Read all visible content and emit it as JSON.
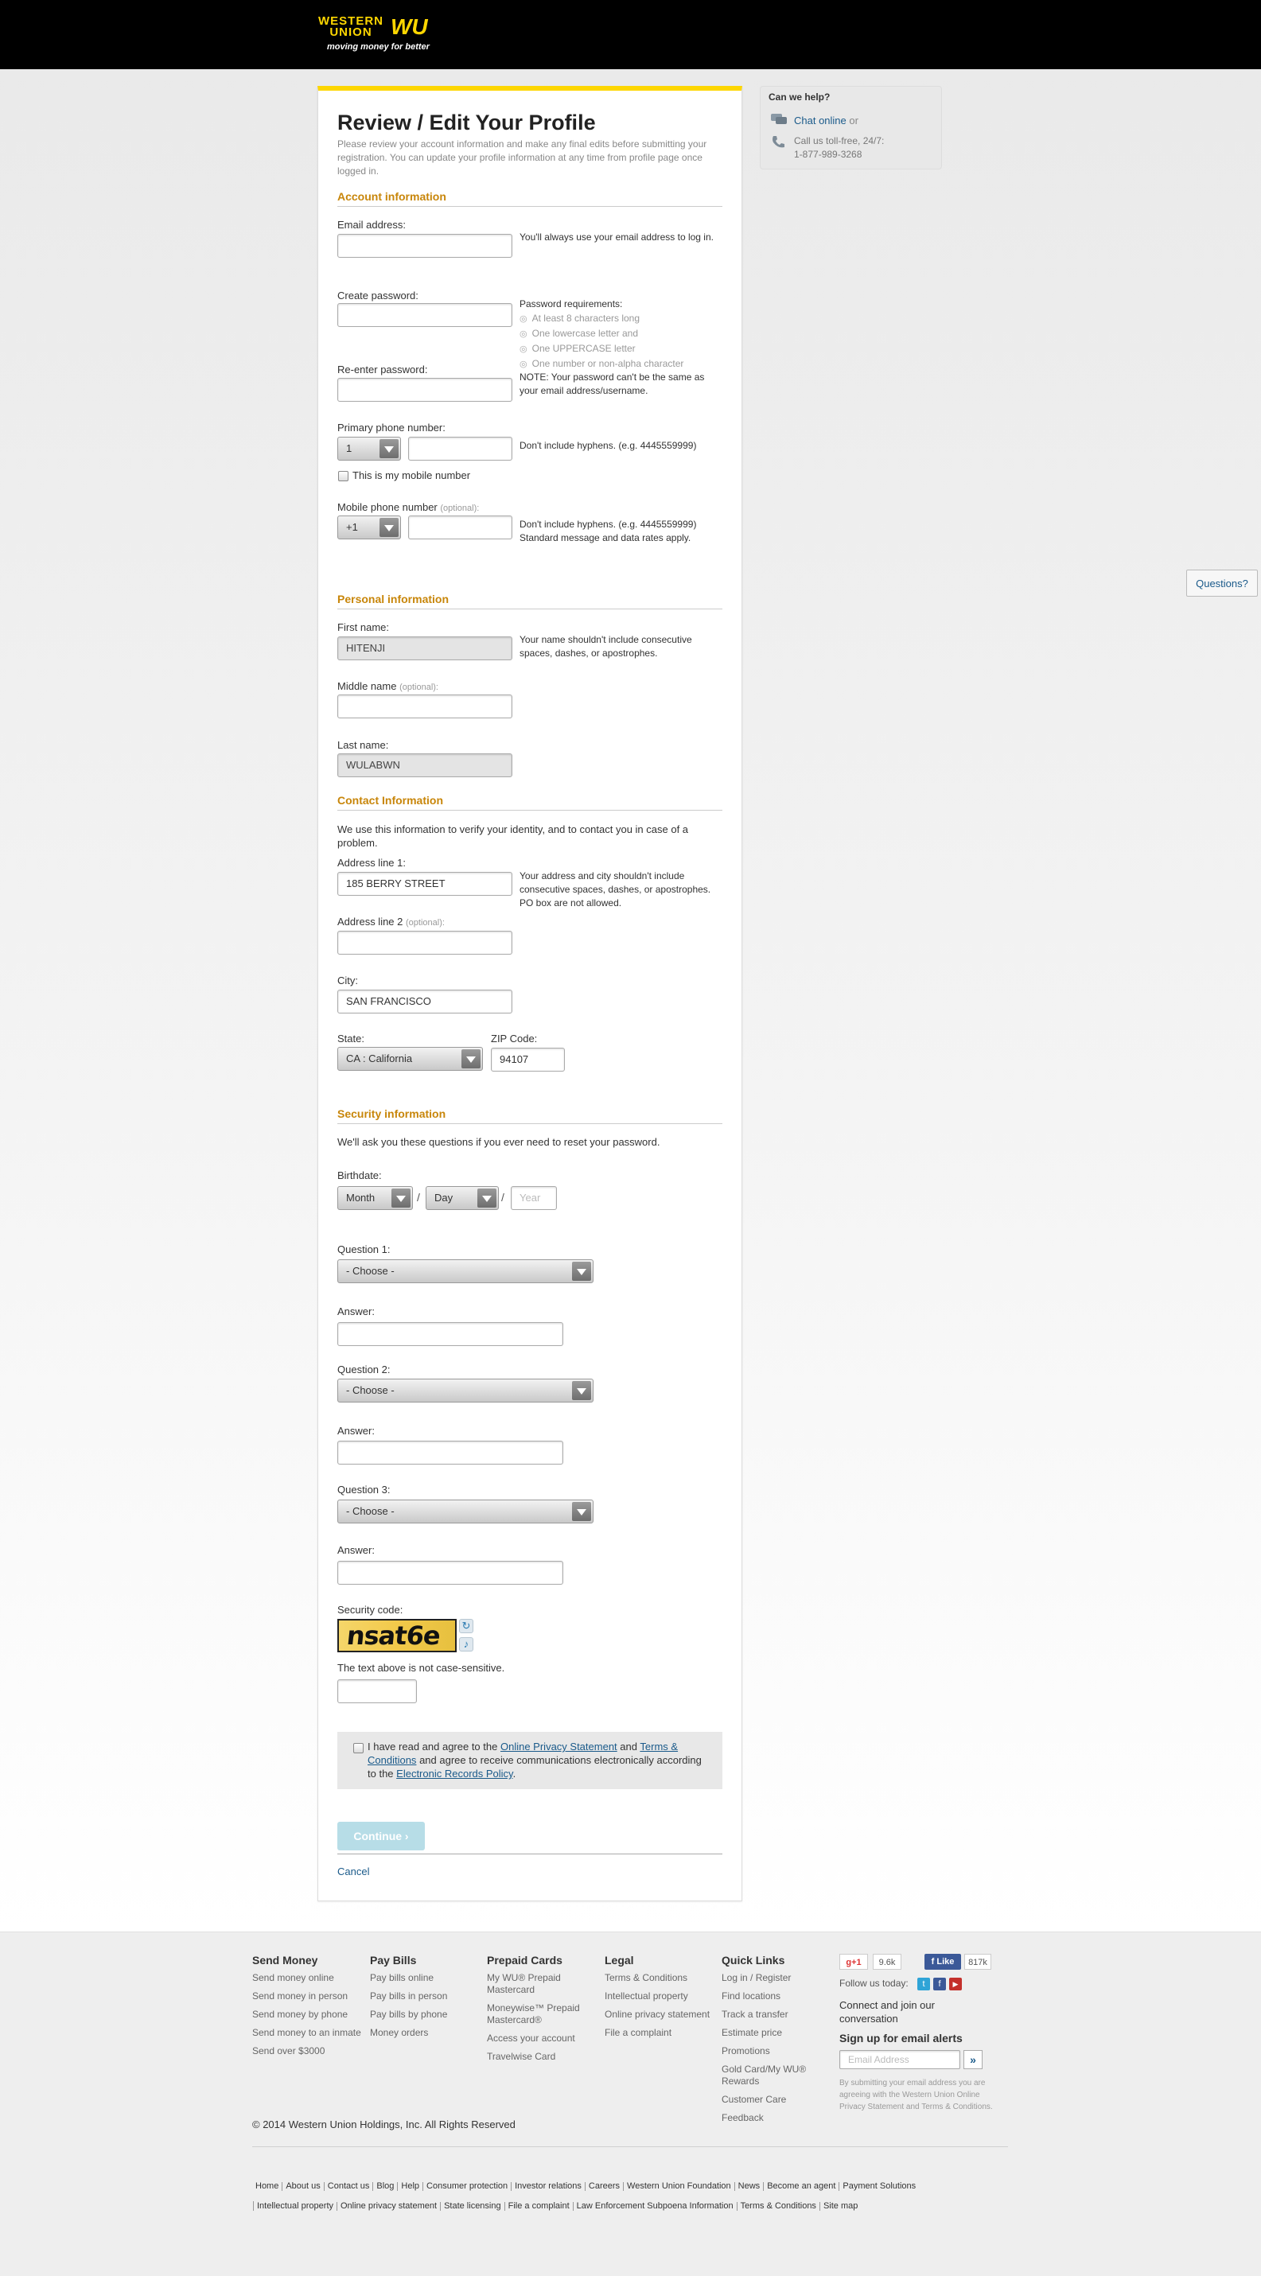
{
  "header": {
    "logo_wordmark_line1": "WESTERN",
    "logo_wordmark_line2": "UNION",
    "logo_mark": "WU",
    "tagline": "moving money for better"
  },
  "page": {
    "title": "Review / Edit Your Profile",
    "intro": "Please review your account information and make any final edits before submitting your registration. You can update your profile information at any time from profile page once logged in."
  },
  "account": {
    "heading": "Account information",
    "email_label": "Email address:",
    "email_hint": "You'll always use your email address to log in.",
    "create_password_label": "Create password:",
    "password_req_title": "Password requirements:",
    "password_reqs": [
      "At least 8 characters long",
      "One lowercase letter and",
      "One UPPERCASE letter",
      "One number or non-alpha character"
    ],
    "reenter_password_label": "Re-enter password:",
    "password_note": "NOTE: Your password can't be the same as your email address/username.",
    "primary_phone_label": "Primary phone number:",
    "primary_phone_code": "1",
    "primary_phone_hint": "Don't include hyphens. (e.g. 4445559999)",
    "mobile_checkbox_label": "This is my mobile number",
    "mobile_phone_label": "Mobile phone number",
    "optional": "(optional):",
    "mobile_phone_code": "+1",
    "mobile_phone_hint": "Don't include hyphens. (e.g. 4445559999) Standard message and data rates apply."
  },
  "personal": {
    "heading": "Personal information",
    "first_name_label": "First name:",
    "first_name_value": "HITENJI",
    "name_hint": "Your name shouldn't include consecutive spaces, dashes, or apostrophes.",
    "middle_name_label": "Middle name",
    "last_name_label": "Last name:",
    "last_name_value": "WULABWN"
  },
  "contact": {
    "heading": "Contact Information",
    "intro": "We use this information to verify your identity, and to contact you in case of a problem.",
    "address1_label": "Address line 1:",
    "address1_value": "185 BERRY STREET",
    "address_hint": "Your address and city shouldn't include consecutive spaces, dashes, or apostrophes. PO box are not allowed.",
    "address2_label": "Address line 2",
    "city_label": "City:",
    "city_value": "SAN FRANCISCO",
    "state_label": "State:",
    "state_value": "CA : California",
    "zip_label": "ZIP Code:",
    "zip_value": "94107"
  },
  "security": {
    "heading": "Security information",
    "intro": "We'll ask you these questions if you ever need to reset your password.",
    "birthdate_label": "Birthdate:",
    "month_value": "Month",
    "day_value": "Day",
    "year_placeholder": "Year",
    "slash": "/",
    "question1_label": "Question 1:",
    "question2_label": "Question 2:",
    "question3_label": "Question 3:",
    "choose_value": "- Choose -",
    "answer_label": "Answer:",
    "security_code_label": "Security code:",
    "captcha_text": "nsat6e",
    "case_note": "The text above is not case-sensitive."
  },
  "agreement": {
    "text_part1": "I have read and agree to the",
    "privacy_link": "Online Privacy Statement",
    "and": "and",
    "terms_link": "Terms & Conditions",
    "text_part2": "and agree to receive communications electronically according to the",
    "records_link": "Electronic Records Policy",
    "period": "."
  },
  "actions": {
    "continue_label": "Continue ›",
    "cancel_label": "Cancel"
  },
  "help": {
    "title": "Can we help?",
    "chat_link": "Chat online",
    "chat_suffix": "or",
    "call_line1": "Call us toll-free, 24/7:",
    "call_line2": "1-877-989-3268"
  },
  "questions_tab": "Questions?",
  "footer": {
    "columns": [
      {
        "title": "Send Money",
        "links": [
          "Send money online",
          "Send money in person",
          "Send money by phone",
          "Send money to an inmate",
          "Send over $3000"
        ]
      },
      {
        "title": "Pay Bills",
        "links": [
          "Pay bills online",
          "Pay bills in person",
          "Pay bills by phone",
          "Money orders"
        ]
      },
      {
        "title": "Prepaid Cards",
        "links": [
          "My WU® Prepaid Mastercard",
          "Moneywise™ Prepaid Mastercard®",
          "Access your account",
          "Travelwise Card"
        ]
      },
      {
        "title": "Legal",
        "links": [
          "Terms & Conditions",
          "Intellectual property",
          "Online privacy statement",
          "File a complaint"
        ]
      },
      {
        "title": "Quick Links",
        "links": [
          "Log in / Register",
          "Find locations",
          "Track a transfer",
          "Estimate price",
          "Promotions",
          "Gold Card/My WU® Rewards",
          "Customer Care",
          "Feedback"
        ]
      }
    ],
    "gplus_label": "g+1",
    "gplus_count": "9.6k",
    "fb_label": "Like",
    "fb_count": "817k",
    "follow_label": "Follow us today:",
    "connect_text": "Connect and join our conversation",
    "signup_title": "Sign up for email alerts",
    "email_placeholder": "Email Address",
    "signup_note": "By submitting your email address you are agreeing with the Western Union Online Privacy Statement and Terms & Conditions.",
    "copyright": "© 2014 Western Union Holdings, Inc. All Rights Reserved",
    "links_row1": [
      "Home",
      "About us",
      "Contact us",
      "Blog",
      "Help",
      "Consumer protection",
      "Investor relations",
      "Careers",
      "Western Union Foundation",
      "News",
      "Become an agent",
      "Payment Solutions"
    ],
    "links_row2": [
      "Intellectual property",
      "Online privacy statement",
      "State licensing",
      "File a complaint",
      "Law Enforcement Subpoena Information",
      "Terms & Conditions",
      "Site map"
    ]
  },
  "colors": {
    "brand_yellow": "#fdd600",
    "section_heading": "#c8860a",
    "link_blue": "#1a5a8a",
    "continue_disabled": "#b7dde7"
  }
}
